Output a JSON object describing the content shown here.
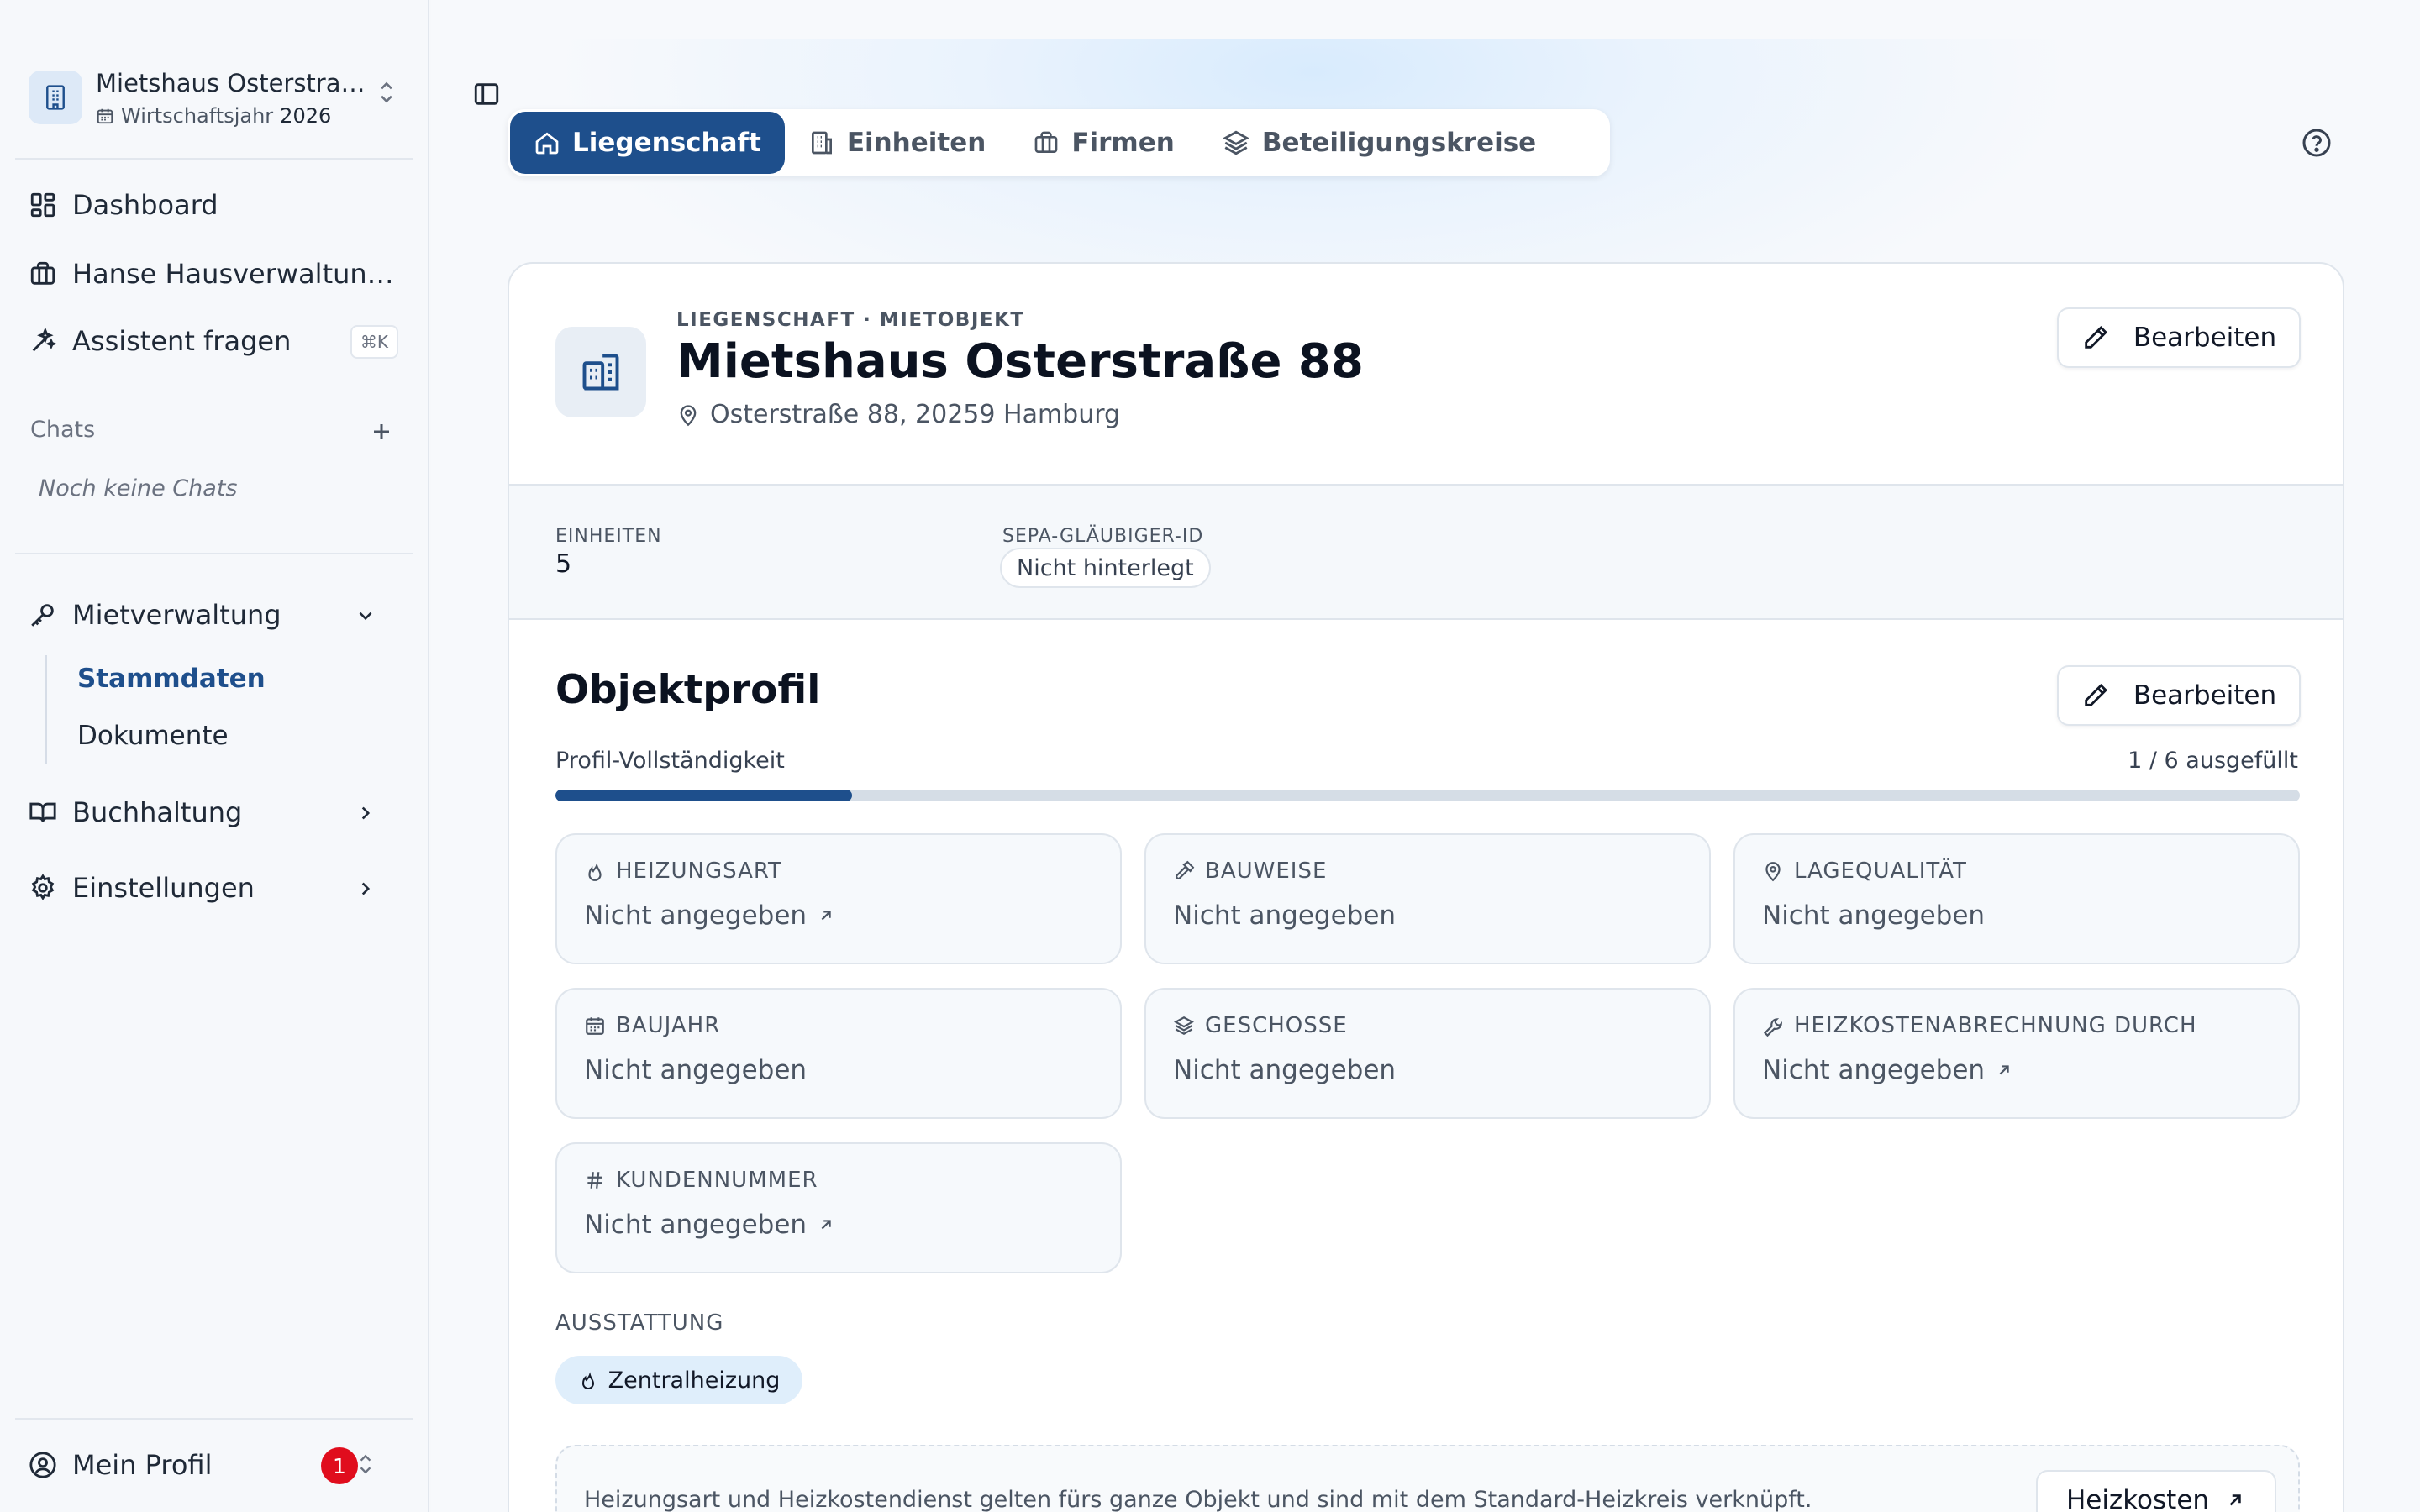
{
  "sidebar": {
    "workspace": {
      "name": "Mietshaus Osterstra…",
      "year_label": "Wirtschaftsjahr",
      "year": "2026"
    },
    "nav": [
      {
        "label": "Dashboard"
      },
      {
        "label": "Hanse Hausverwaltun…"
      },
      {
        "label": "Assistent fragen",
        "shortcut": "⌘K"
      }
    ],
    "chats": {
      "label": "Chats",
      "empty": "Noch keine Chats"
    },
    "groups": [
      {
        "label": "Mietverwaltung",
        "items": [
          "Stammdaten",
          "Dokumente"
        ],
        "active": "Stammdaten"
      },
      {
        "label": "Buchhaltung"
      },
      {
        "label": "Einstellungen"
      }
    ],
    "profile": {
      "label": "Mein Profil",
      "badge": "1"
    }
  },
  "tabs": [
    {
      "label": "Liegenschaft",
      "active": true
    },
    {
      "label": "Einheiten"
    },
    {
      "label": "Firmen"
    },
    {
      "label": "Beteiligungskreise"
    }
  ],
  "property": {
    "eyebrow": "LIEGENSCHAFT · MIETOBJEKT",
    "title": "Mietshaus Osterstraße 88",
    "address": "Osterstraße 88, 20259 Hamburg",
    "edit_label": "Bearbeiten",
    "units_label": "EINHEITEN",
    "units_value": "5",
    "sepa_label": "SEPA-GLÄUBIGER-ID",
    "sepa_value": "Nicht hinterlegt"
  },
  "profile": {
    "title": "Objektprofil",
    "edit_label": "Bearbeiten",
    "completeness_label": "Profil-Vollständigkeit",
    "completeness_text": "1 / 6 ausgefüllt",
    "completeness_fraction": 0.17,
    "fields": [
      {
        "label": "HEIZUNGSART",
        "value": "Nicht angegeben",
        "icon": "flame-icon",
        "link": true
      },
      {
        "label": "BAUWEISE",
        "value": "Nicht angegeben",
        "icon": "hammer-icon",
        "link": false
      },
      {
        "label": "LAGEQUALITÄT",
        "value": "Nicht angegeben",
        "icon": "map-pin-icon",
        "link": false
      },
      {
        "label": "BAUJAHR",
        "value": "Nicht angegeben",
        "icon": "calendar-icon",
        "link": false
      },
      {
        "label": "GESCHOSSE",
        "value": "Nicht angegeben",
        "icon": "layers-icon",
        "link": false
      },
      {
        "label": "HEIZKOSTENABRECHNUNG DURCH",
        "value": "Nicht angegeben",
        "icon": "wrench-icon",
        "link": true
      },
      {
        "label": "KUNDENNUMMER",
        "value": "Nicht angegeben",
        "icon": "hash-icon",
        "link": true
      }
    ],
    "equipment_label": "AUSSTATTUNG",
    "equipment": [
      "Zentralheizung"
    ],
    "info_text": "Heizungsart und Heizkostendienst gelten fürs ganze Objekt und sind mit dem Standard-Heizkreis verknüpft.",
    "info_button": "Heizkosten"
  },
  "colors": {
    "accent": "#1e4f8c",
    "badge": "#e00d1d",
    "chip": "#dfeefb"
  }
}
